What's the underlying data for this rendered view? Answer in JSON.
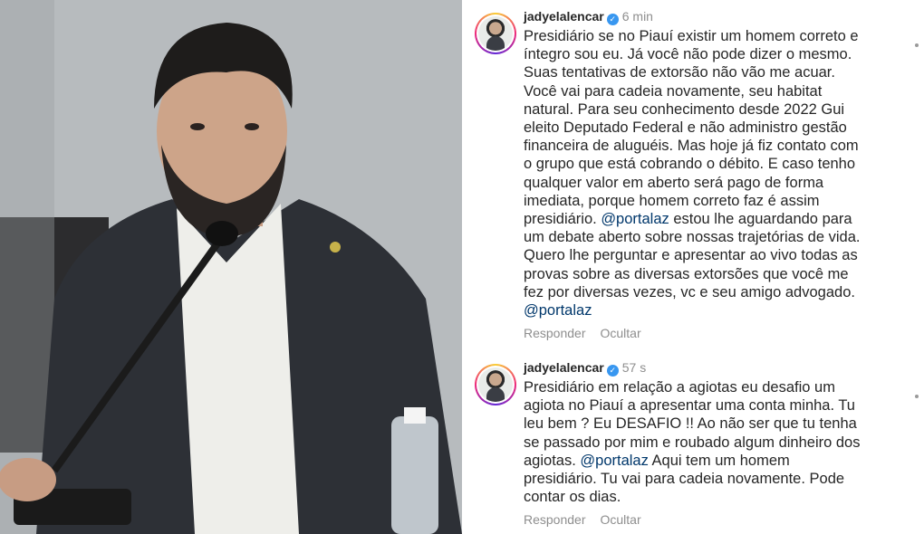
{
  "comments": [
    {
      "username": "jadyelalencar",
      "time": "6 min",
      "lines": [
        "Presidiário se no Piauí existir um homem correto e",
        "íntegro sou eu. Já você não pode dizer o mesmo.",
        "Suas tentativas de extorsão não vão me acuar.",
        "Você vai para cadeia novamente, seu habitat",
        "natural. Para seu conhecimento desde 2022 Gui",
        "eleito Deputado Federal e não administro gestão",
        "financeira de aluguéis. Mas hoje já fiz contato com",
        "o grupo que está cobrando o débito. E caso tenho",
        "qualquer valor em aberto será pago de forma",
        "imediata, porque homem correto faz é assim",
        "presidiário.",
        "um debate aberto sobre nossas trajetórias de vida.",
        "Quero lhe perguntar e apresentar ao vivo todas as",
        "provas sobre as diversas extorsões que você me",
        "fez por diversas vezes, vc e seu amigo advogado."
      ],
      "mention": "@portalaz",
      "line11_rest": " estou lhe aguardando para",
      "reply_label": "Responder",
      "hide_label": "Ocultar"
    },
    {
      "username": "jadyelalencar",
      "time": "57 s",
      "lines": [
        "Presidiário em relação a agiotas eu desafio um",
        "agiota no Piauí a apresentar uma conta minha. Tu",
        "leu bem ? Eu DESAFIO !! Ao não ser que tu tenha",
        "se passado por mim e roubado algum dinheiro dos",
        "agiotas.",
        "presidiário. Tu vai para cadeia novamente. Pode",
        "contar os dias."
      ],
      "mention": "@portalaz",
      "line5_rest": " Aqui tem um homem",
      "reply_label": "Responder",
      "hide_label": "Ocultar"
    }
  ],
  "icons": {
    "verified": "verified-badge-icon",
    "avatar": "profile-avatar"
  },
  "colors": {
    "mention": "#00376b",
    "verified": "#3897f0",
    "muted": "#8e8e8e",
    "text": "#262626"
  }
}
